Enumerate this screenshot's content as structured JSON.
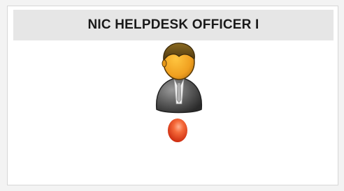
{
  "card": {
    "title": "NIC HELPDESK OFFICER I"
  },
  "avatar": {
    "icon": "user-officer-icon"
  },
  "status": {
    "icon": "status-red-dot-icon",
    "color": "#e8401c"
  }
}
